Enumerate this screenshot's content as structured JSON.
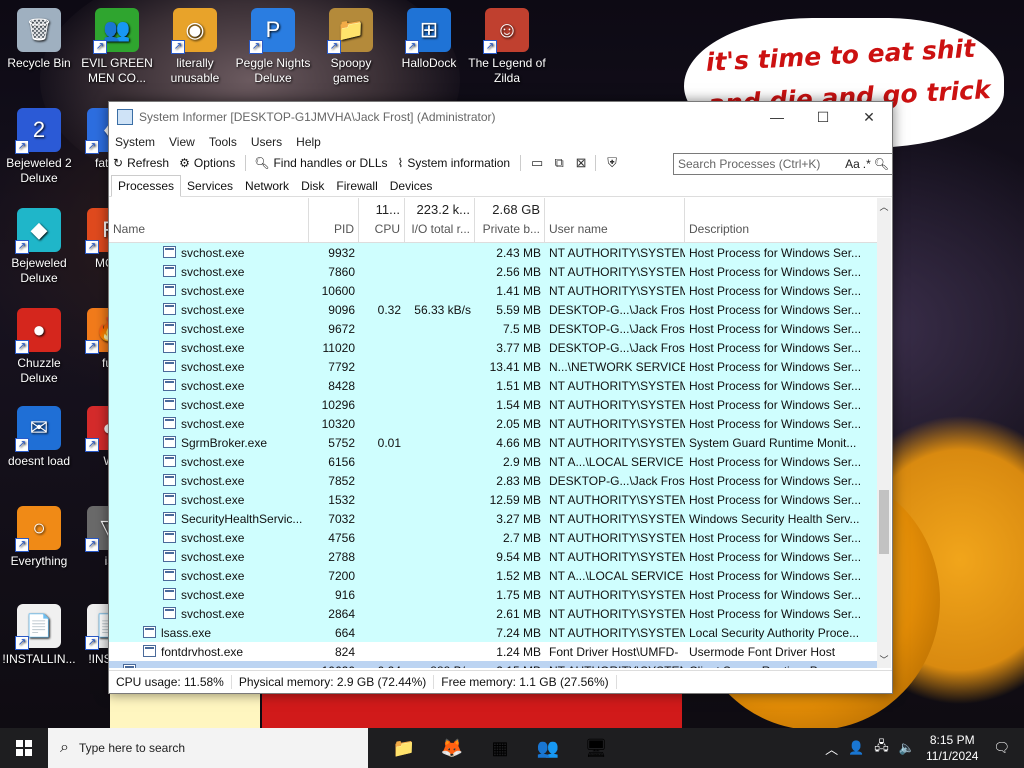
{
  "desktop": {
    "bubble_text": "it's time to eat shit and die and go trick or vote!",
    "icons": [
      {
        "label": "Recycle Bin",
        "glyph": "🗑"
      },
      {
        "label": "EVIL GREEN MEN CO...",
        "glyph": "👥"
      },
      {
        "label": "literally unusable",
        "glyph": "◉"
      },
      {
        "label": "Peggle Nights Deluxe",
        "glyph": "P"
      },
      {
        "label": "Spoopy games",
        "glyph": "📁"
      },
      {
        "label": "HalloDock",
        "glyph": "⊞"
      },
      {
        "label": "The Legend of Zilda",
        "glyph": "☺"
      },
      {
        "label": "Bejeweled 2 Deluxe",
        "glyph": "2"
      },
      {
        "label": "fat lik",
        "glyph": "♦"
      },
      {
        "label": "Bejeweled Deluxe",
        "glyph": "◆"
      },
      {
        "label": "MON",
        "glyph": "F"
      },
      {
        "label": "Chuzzle Deluxe",
        "glyph": "●"
      },
      {
        "label": "fur",
        "glyph": "🔥"
      },
      {
        "label": "doesnt load",
        "glyph": "✉"
      },
      {
        "label": "W",
        "glyph": "●"
      },
      {
        "label": "Everything",
        "glyph": "○"
      },
      {
        "label": "is",
        "glyph": "▽"
      },
      {
        "label": "!INSTALLIN...",
        "glyph": "📄"
      },
      {
        "label": "!INS -Si",
        "glyph": "📄"
      }
    ]
  },
  "window": {
    "title": "System Informer [DESKTOP-G1JMVHA\\Jack Frost] (Administrator)",
    "controls": {
      "minimize": "—",
      "maximize": "☐",
      "close": "✕"
    },
    "menu": [
      "System",
      "View",
      "Tools",
      "Users",
      "Help"
    ],
    "toolbar": {
      "refresh": "Refresh",
      "options": "Options",
      "find": "Find handles or DLLs",
      "sysinfo": "System information"
    },
    "search": {
      "placeholder": "Search Processes (Ctrl+K)",
      "aa": "Aa",
      "regex": ".*"
    },
    "tabs": [
      "Processes",
      "Services",
      "Network",
      "Disk",
      "Firewall",
      "Devices"
    ],
    "columns": {
      "name": "Name",
      "pid": "PID",
      "cpu_total": "11...",
      "cpu": "CPU",
      "io_total": "223.2 k...",
      "io": "I/O total r...",
      "priv_total": "2.68 GB",
      "priv": "Private b...",
      "user": "User name",
      "desc": "Description"
    },
    "rows": [
      {
        "name": "svchost.exe",
        "pid": "9932",
        "cpu": "",
        "io": "",
        "priv": "2.43 MB",
        "user": "NT AUTHORITY\\SYSTEM",
        "desc": "Host Process for Windows Ser...",
        "indent": 2,
        "bg": "cyan"
      },
      {
        "name": "svchost.exe",
        "pid": "7860",
        "cpu": "",
        "io": "",
        "priv": "2.56 MB",
        "user": "NT AUTHORITY\\SYSTEM",
        "desc": "Host Process for Windows Ser...",
        "indent": 2,
        "bg": "cyan"
      },
      {
        "name": "svchost.exe",
        "pid": "10600",
        "cpu": "",
        "io": "",
        "priv": "1.41 MB",
        "user": "NT AUTHORITY\\SYSTEM",
        "desc": "Host Process for Windows Ser...",
        "indent": 2,
        "bg": "cyan"
      },
      {
        "name": "svchost.exe",
        "pid": "9096",
        "cpu": "0.32",
        "io": "56.33 kB/s",
        "priv": "5.59 MB",
        "user": "DESKTOP-G...\\Jack Frost",
        "desc": "Host Process for Windows Ser...",
        "indent": 2,
        "bg": "cyan"
      },
      {
        "name": "svchost.exe",
        "pid": "9672",
        "cpu": "",
        "io": "",
        "priv": "7.5 MB",
        "user": "DESKTOP-G...\\Jack Frost",
        "desc": "Host Process for Windows Ser...",
        "indent": 2,
        "bg": "cyan"
      },
      {
        "name": "svchost.exe",
        "pid": "11020",
        "cpu": "",
        "io": "",
        "priv": "3.77 MB",
        "user": "DESKTOP-G...\\Jack Frost",
        "desc": "Host Process for Windows Ser...",
        "indent": 2,
        "bg": "cyan"
      },
      {
        "name": "svchost.exe",
        "pid": "7792",
        "cpu": "",
        "io": "",
        "priv": "13.41 MB",
        "user": "N...\\NETWORK SERVICE",
        "desc": "Host Process for Windows Ser...",
        "indent": 2,
        "bg": "cyan"
      },
      {
        "name": "svchost.exe",
        "pid": "8428",
        "cpu": "",
        "io": "",
        "priv": "1.51 MB",
        "user": "NT AUTHORITY\\SYSTEM",
        "desc": "Host Process for Windows Ser...",
        "indent": 2,
        "bg": "cyan"
      },
      {
        "name": "svchost.exe",
        "pid": "10296",
        "cpu": "",
        "io": "",
        "priv": "1.54 MB",
        "user": "NT AUTHORITY\\SYSTEM",
        "desc": "Host Process for Windows Ser...",
        "indent": 2,
        "bg": "cyan"
      },
      {
        "name": "svchost.exe",
        "pid": "10320",
        "cpu": "",
        "io": "",
        "priv": "2.05 MB",
        "user": "NT AUTHORITY\\SYSTEM",
        "desc": "Host Process for Windows Ser...",
        "indent": 2,
        "bg": "cyan"
      },
      {
        "name": "SgrmBroker.exe",
        "pid": "5752",
        "cpu": "0.01",
        "io": "",
        "priv": "4.66 MB",
        "user": "NT AUTHORITY\\SYSTEM",
        "desc": "System Guard Runtime Monit...",
        "indent": 2,
        "bg": "cyan"
      },
      {
        "name": "svchost.exe",
        "pid": "6156",
        "cpu": "",
        "io": "",
        "priv": "2.9 MB",
        "user": "NT A...\\LOCAL SERVICE",
        "desc": "Host Process for Windows Ser...",
        "indent": 2,
        "bg": "cyan"
      },
      {
        "name": "svchost.exe",
        "pid": "7852",
        "cpu": "",
        "io": "",
        "priv": "2.83 MB",
        "user": "DESKTOP-G...\\Jack Frost",
        "desc": "Host Process for Windows Ser...",
        "indent": 2,
        "bg": "cyan"
      },
      {
        "name": "svchost.exe",
        "pid": "1532",
        "cpu": "",
        "io": "",
        "priv": "12.59 MB",
        "user": "NT AUTHORITY\\SYSTEM",
        "desc": "Host Process for Windows Ser...",
        "indent": 2,
        "bg": "cyan"
      },
      {
        "name": "SecurityHealthServic...",
        "pid": "7032",
        "cpu": "",
        "io": "",
        "priv": "3.27 MB",
        "user": "NT AUTHORITY\\SYSTEM",
        "desc": "Windows Security Health Serv...",
        "indent": 2,
        "bg": "cyan"
      },
      {
        "name": "svchost.exe",
        "pid": "4756",
        "cpu": "",
        "io": "",
        "priv": "2.7 MB",
        "user": "NT AUTHORITY\\SYSTEM",
        "desc": "Host Process for Windows Ser...",
        "indent": 2,
        "bg": "cyan"
      },
      {
        "name": "svchost.exe",
        "pid": "2788",
        "cpu": "",
        "io": "",
        "priv": "9.54 MB",
        "user": "NT AUTHORITY\\SYSTEM",
        "desc": "Host Process for Windows Ser...",
        "indent": 2,
        "bg": "cyan"
      },
      {
        "name": "svchost.exe",
        "pid": "7200",
        "cpu": "",
        "io": "",
        "priv": "1.52 MB",
        "user": "NT A...\\LOCAL SERVICE",
        "desc": "Host Process for Windows Ser...",
        "indent": 2,
        "bg": "cyan"
      },
      {
        "name": "svchost.exe",
        "pid": "916",
        "cpu": "",
        "io": "",
        "priv": "1.75 MB",
        "user": "NT AUTHORITY\\SYSTEM",
        "desc": "Host Process for Windows Ser...",
        "indent": 2,
        "bg": "cyan"
      },
      {
        "name": "svchost.exe",
        "pid": "2864",
        "cpu": "",
        "io": "",
        "priv": "2.61 MB",
        "user": "NT AUTHORITY\\SYSTEM",
        "desc": "Host Process for Windows Ser...",
        "indent": 2,
        "bg": "cyan"
      },
      {
        "name": "lsass.exe",
        "pid": "664",
        "cpu": "",
        "io": "",
        "priv": "7.24 MB",
        "user": "NT AUTHORITY\\SYSTEM",
        "desc": "Local Security Authority Proce...",
        "indent": 1,
        "bg": "cyan"
      },
      {
        "name": "fontdrvhost.exe",
        "pid": "824",
        "cpu": "",
        "io": "",
        "priv": "1.24 MB",
        "user": "Font Driver Host\\UMFD-",
        "desc": "Usermode Font Driver Host",
        "indent": 1,
        "bg": "white"
      },
      {
        "name": "csrss.exe",
        "pid": "10620",
        "cpu": "0.24",
        "io": "888 B/s",
        "priv": "2.15 MB",
        "user": "NT AUTHORITY\\SYSTEM",
        "desc": "Client Server Runtime Process",
        "indent": 0,
        "bg": "sel"
      }
    ],
    "status": {
      "cpu": "CPU usage: 11.58%",
      "phys": "Physical memory: 2.9 GB (72.44%)",
      "free": "Free memory: 1.1 GB (27.56%)"
    }
  },
  "taskbar": {
    "search_placeholder": "Type here to search",
    "apps": [
      "📁",
      "🦊",
      "▦",
      "👥",
      "🖥"
    ],
    "time": "8:15 PM",
    "date": "11/1/2024"
  },
  "colors": {
    "row_cyan": "#cffefe",
    "row_selected": "#bcd4f2",
    "bubble_text": "#cc1111",
    "taskbar": "#1e1e20"
  }
}
